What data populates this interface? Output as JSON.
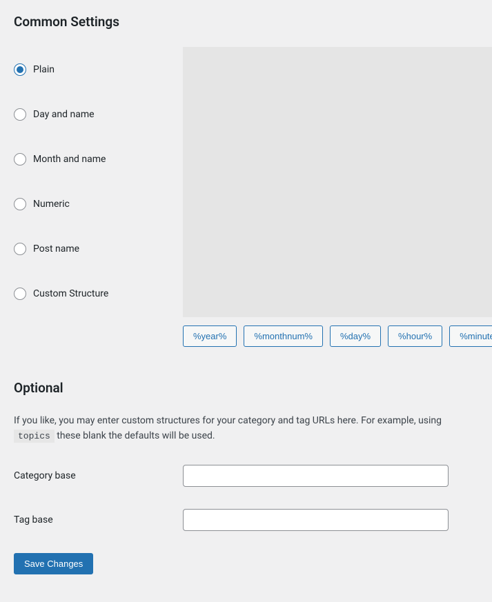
{
  "sections": {
    "common_settings": {
      "title": "Common Settings",
      "options": [
        {
          "label": "Plain",
          "checked": true
        },
        {
          "label": "Day and name",
          "checked": false
        },
        {
          "label": "Month and name",
          "checked": false
        },
        {
          "label": "Numeric",
          "checked": false
        },
        {
          "label": "Post name",
          "checked": false
        },
        {
          "label": "Custom Structure",
          "checked": false
        }
      ],
      "tags": [
        "%year%",
        "%monthnum%",
        "%day%",
        "%hour%",
        "%minute%"
      ]
    },
    "optional": {
      "title": "Optional",
      "desc_prefix": "If you like, you may enter custom structures for your category and tag URLs here. For example, using ",
      "desc_code": "topics",
      "desc_suffix": " these blank the defaults will be used.",
      "category_base_label": "Category base",
      "category_base_value": "",
      "tag_base_label": "Tag base",
      "tag_base_value": ""
    },
    "save_label": "Save Changes"
  }
}
